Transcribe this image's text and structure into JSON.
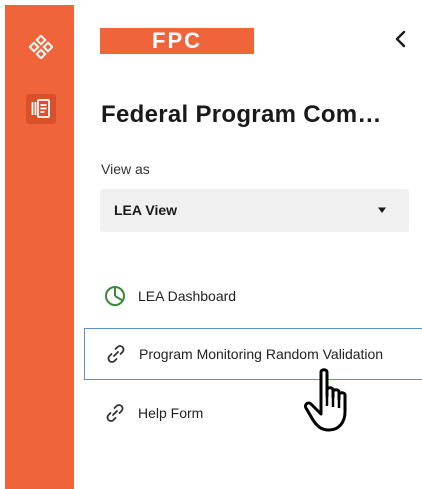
{
  "brand": {
    "logo_text": "FPC",
    "accent_color": "#f0643c"
  },
  "header": {
    "title": "Federal Program Com…",
    "back_icon": "chevron-left-icon"
  },
  "rail": {
    "items": [
      {
        "icon": "diamond-grid-icon"
      },
      {
        "icon": "document-list-icon",
        "active": true
      }
    ]
  },
  "view_as": {
    "label": "View as",
    "selected": "LEA View",
    "caret_icon": "caret-down-icon"
  },
  "nav": {
    "items": [
      {
        "label": "LEA Dashboard",
        "icon": "pie-chart-icon",
        "active": false
      },
      {
        "label": "Program Monitoring Random Validation",
        "icon": "link-icon",
        "active": true
      },
      {
        "label": "Help Form",
        "icon": "link-icon",
        "active": false
      }
    ]
  },
  "colors": {
    "active_border": "#5b8fd1",
    "icon_green": "#3a8a3a"
  }
}
